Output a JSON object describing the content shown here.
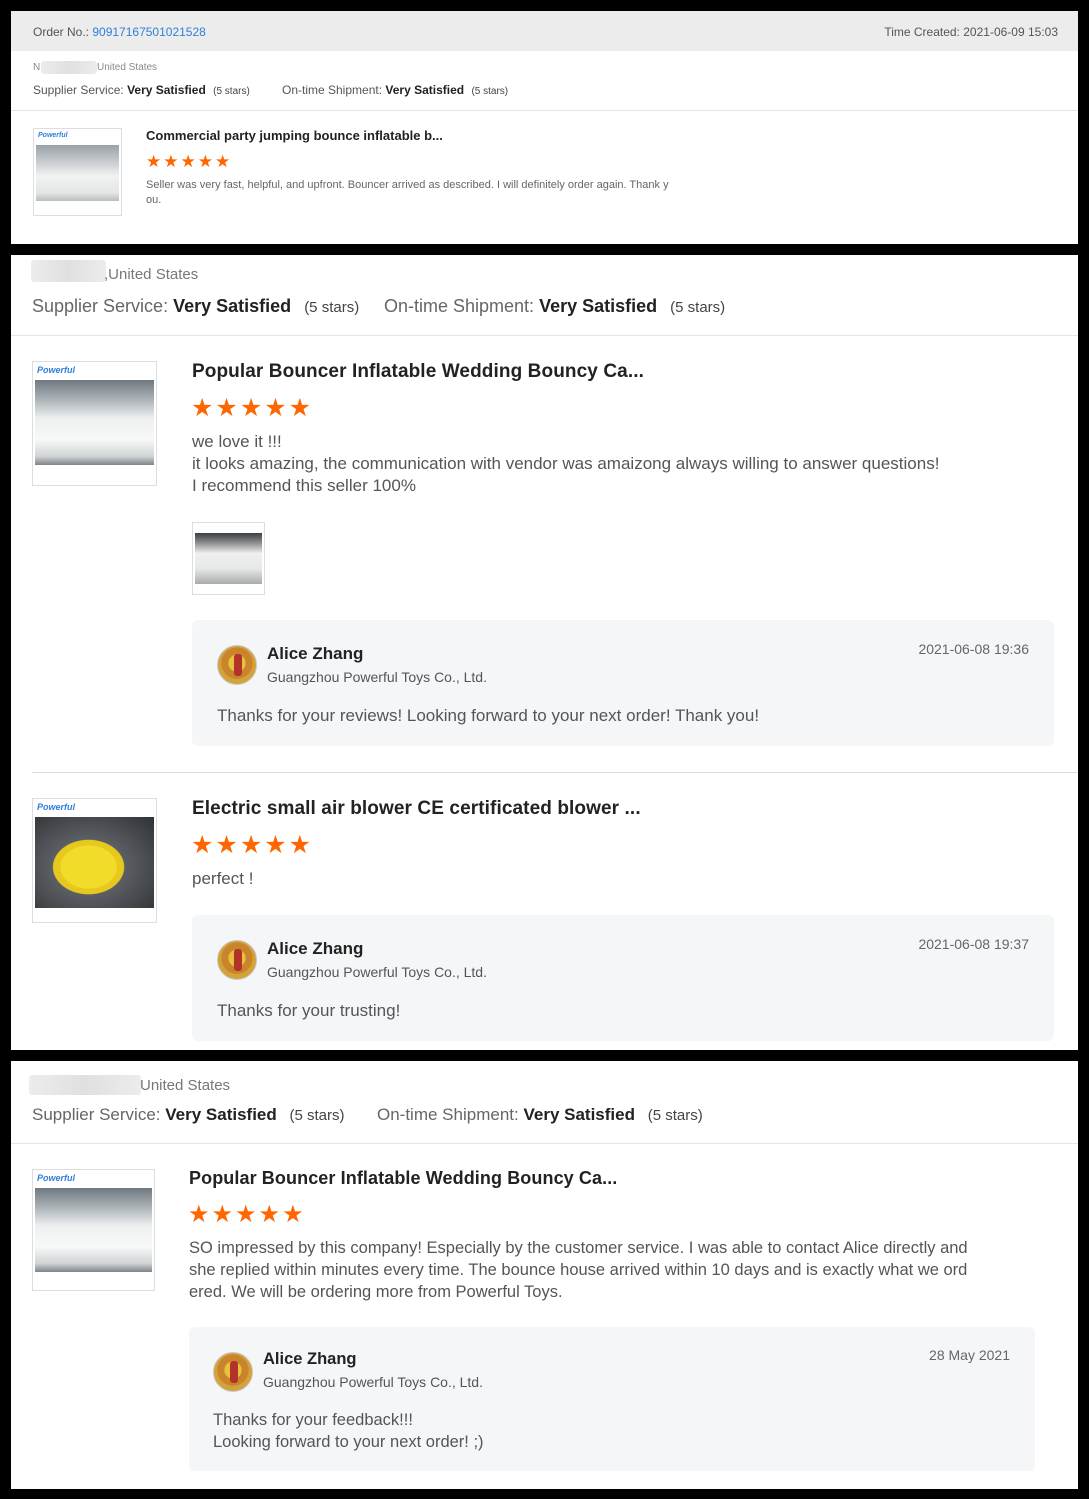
{
  "order": {
    "label": "Order No.:",
    "number": "90917167501021528",
    "time_label": "Time Created:",
    "time": "2021-06-09 15:03",
    "location_prefix": "N",
    "location": "United States",
    "supplier_service_label": "Supplier Service:",
    "supplier_service_value": "Very Satisfied",
    "supplier_service_stars": "(5 stars)",
    "shipment_label": "On-time Shipment:",
    "shipment_value": "Very Satisfied",
    "shipment_stars": "(5 stars)",
    "product": {
      "logo": "Powerful",
      "title": "Commercial party jumping bounce inflatable b...",
      "stars": "★★★★★",
      "review_line1": "Seller was very fast, helpful, and upfront. Bouncer arrived as described. I will definitely order again. Thank y",
      "review_line2": "ou."
    }
  },
  "review2": {
    "location": ",United States",
    "supplier_service_label": "Supplier Service:",
    "supplier_service_value": "Very Satisfied",
    "supplier_service_stars": "(5 stars)",
    "shipment_label": "On-time Shipment:",
    "shipment_value": "Very Satisfied",
    "shipment_stars": "(5 stars)",
    "items": [
      {
        "logo": "Powerful",
        "title": "Popular Bouncer Inflatable Wedding Bouncy Ca...",
        "stars": "★★★★★",
        "review_lines": [
          "we love it !!!",
          "it looks amazing, the communication with vendor was amaizong always willing to answer questions!",
          "I recommend this seller 100%"
        ],
        "reply": {
          "name": "Alice Zhang",
          "company": "Guangzhou Powerful Toys Co., Ltd.",
          "date": "2021-06-08 19:36",
          "text": "Thanks for your reviews! Looking forward to your next order!  Thank you!"
        }
      },
      {
        "logo": "Powerful",
        "title": "Electric small air blower CE certificated blower ...",
        "stars": "★★★★★",
        "review_lines": [
          "perfect !"
        ],
        "reply": {
          "name": "Alice Zhang",
          "company": "Guangzhou Powerful Toys Co., Ltd.",
          "date": "2021-06-08 19:37",
          "text": "Thanks for your trusting!"
        }
      }
    ]
  },
  "review3": {
    "location": "United States",
    "supplier_service_label": "Supplier Service:",
    "supplier_service_value": "Very Satisfied",
    "supplier_service_stars": "(5 stars)",
    "shipment_label": "On-time Shipment:",
    "shipment_value": "Very Satisfied",
    "shipment_stars": "(5 stars)",
    "item": {
      "logo": "Powerful",
      "title": "Popular Bouncer Inflatable Wedding Bouncy Ca...",
      "stars": "★★★★★",
      "review_lines": [
        "SO impressed by this company! Especially by the customer service. I was able to contact Alice directly and",
        "she replied within minutes every time. The bounce house arrived within 10 days and is exactly what we ord",
        "ered. We will be ordering more from Powerful Toys."
      ],
      "reply": {
        "name": "Alice Zhang",
        "company": "Guangzhou Powerful Toys Co., Ltd.",
        "date": "28 May 2021",
        "text_lines": [
          "Thanks for your feedback!!!",
          "Looking forward to your next order! ;)"
        ]
      }
    }
  }
}
